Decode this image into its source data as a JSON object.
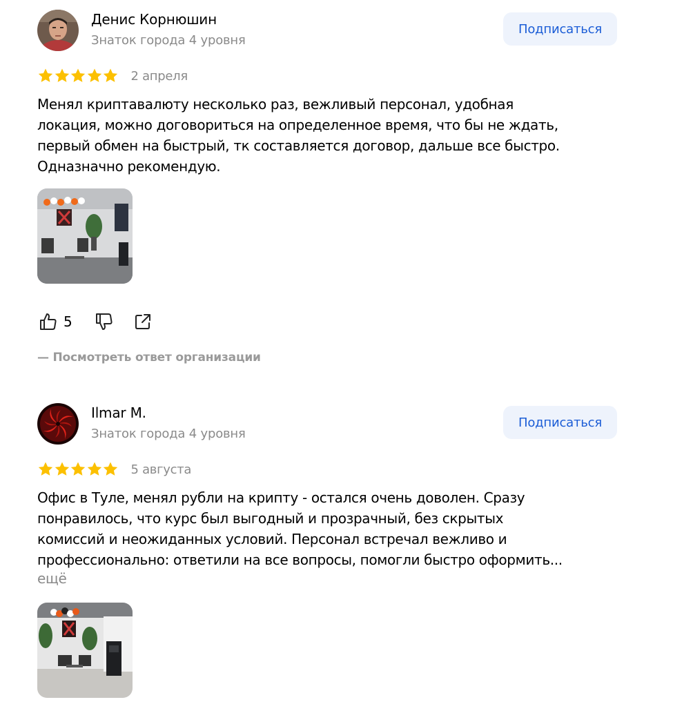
{
  "reviews": [
    {
      "author_name": "Денис Корнюшин",
      "author_level": "Знаток города 4 уровня",
      "subscribe_label": "Подписаться",
      "rating": 5,
      "date": "2 апреля",
      "text": "Менял криптавалюту несколько раз, вежливый персонал, удобная\nлокация, можно договориться на определенное время, что бы не ждать,\nпервый обмен на быстрый, тк составляется договор, дальше все быстро.\nОдназначно рекомендую.",
      "photo_count": 1,
      "likes": "5",
      "reply_link": "— Посмотреть ответ организации"
    },
    {
      "author_name": "Ilmar M.",
      "author_level": "Знаток города 4 уровня",
      "subscribe_label": "Подписаться",
      "rating": 5,
      "date": "5 августа",
      "text": "Офис в Туле, менял рубли на крипту - остался очень доволен. Сразу\nпонравилось, что курс был выгодный и прозрачный, без скрытых\nкомиссий и неожиданных условий. Персонал встречал вежливо и\nпрофессионально: ответили на все вопросы, помогли быстро оформить...",
      "more_label": "ещё",
      "photo_count": 1
    }
  ],
  "colors": {
    "star": "#fcc000",
    "subscribe_bg": "#eef3fc",
    "subscribe_text": "#1a5cd6",
    "muted_text": "#8a8a8a"
  },
  "icons": {
    "like": "thumbs-up-icon",
    "dislike": "thumbs-down-icon",
    "share": "share-icon"
  }
}
